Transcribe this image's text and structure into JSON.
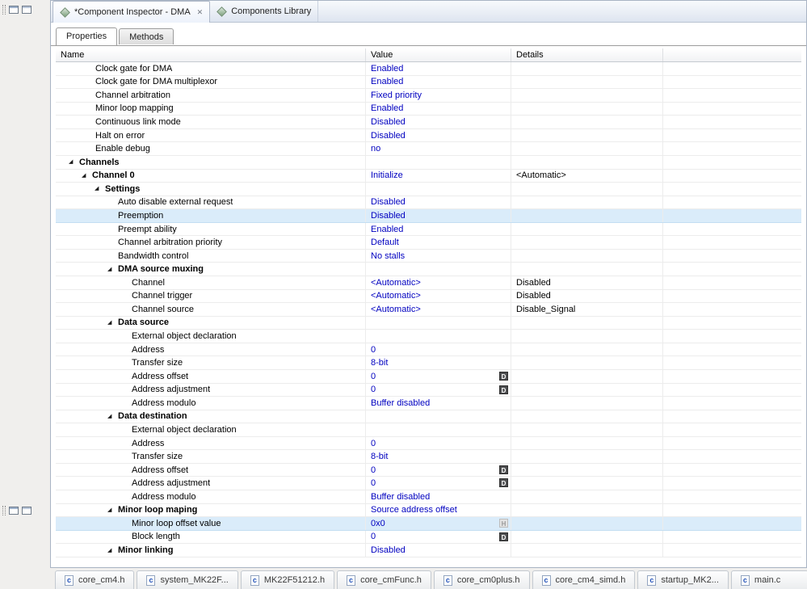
{
  "colors": {
    "value_text": "#0000c0",
    "selection_bg": "#daecfa",
    "tab_bar_bg": "#dde4f0",
    "badge_dark_bg": "#4d4e50",
    "badge_light_bg": "#e3e3e3"
  },
  "icons": {
    "close": "✕",
    "expander": "◢",
    "c_file": "c",
    "editor_tab_icon": "component-icon",
    "file_tab_icon": "c-file-icon"
  },
  "editor_tabs": [
    {
      "label": "*Component Inspector - DMA",
      "active": true,
      "closable": true
    },
    {
      "label": "Components Library",
      "active": false
    }
  ],
  "view_tabs": [
    {
      "label": "Properties",
      "active": true
    },
    {
      "label": "Methods",
      "active": false
    }
  ],
  "table": {
    "columns": [
      "Name",
      "Value",
      "Details",
      ""
    ],
    "rows": [
      {
        "indent": 49,
        "name": "Clock gate for DMA",
        "value": "Enabled"
      },
      {
        "indent": 49,
        "name": "Clock gate for DMA multiplexor",
        "value": "Enabled"
      },
      {
        "indent": 49,
        "name": "Channel arbitration",
        "value": "Fixed priority"
      },
      {
        "indent": 49,
        "name": "Minor loop mapping",
        "value": "Enabled"
      },
      {
        "indent": 49,
        "name": "Continuous link mode",
        "value": "Disabled"
      },
      {
        "indent": 49,
        "name": "Halt on error",
        "value": "Disabled"
      },
      {
        "indent": 49,
        "name": "Enable debug",
        "value": "no"
      },
      {
        "indent": 16,
        "name": "Channels",
        "group": true
      },
      {
        "indent": 32,
        "name": "Channel 0",
        "group": true,
        "value": "Initialize",
        "details": "<Automatic>"
      },
      {
        "indent": 48,
        "name": "Settings",
        "group": true
      },
      {
        "indent": 77,
        "name": "Auto disable external request",
        "value": "Disabled"
      },
      {
        "indent": 77,
        "name": "Preemption",
        "value": "Disabled",
        "selected": true
      },
      {
        "indent": 77,
        "name": "Preempt ability",
        "value": "Enabled"
      },
      {
        "indent": 77,
        "name": "Channel arbitration priority",
        "value": "Default"
      },
      {
        "indent": 77,
        "name": "Bandwidth control",
        "value": "No stalls"
      },
      {
        "indent": 64,
        "name": "DMA source muxing",
        "group": true
      },
      {
        "indent": 94,
        "name": "Channel",
        "value": "<Automatic>",
        "details": "Disabled"
      },
      {
        "indent": 94,
        "name": "Channel trigger",
        "value": "<Automatic>",
        "details": "Disabled"
      },
      {
        "indent": 94,
        "name": "Channel source",
        "value": "<Automatic>",
        "details": "Disable_Signal"
      },
      {
        "indent": 64,
        "name": "Data source",
        "group": true
      },
      {
        "indent": 94,
        "name": "External object declaration",
        "value": ""
      },
      {
        "indent": 94,
        "name": "Address",
        "value": "0"
      },
      {
        "indent": 94,
        "name": "Transfer size",
        "value": "8-bit"
      },
      {
        "indent": 94,
        "name": "Address offset",
        "value": "0",
        "badge": "D"
      },
      {
        "indent": 94,
        "name": "Address adjustment",
        "value": "0",
        "badge": "D"
      },
      {
        "indent": 94,
        "name": "Address modulo",
        "value": "Buffer disabled"
      },
      {
        "indent": 64,
        "name": "Data destination",
        "group": true
      },
      {
        "indent": 94,
        "name": "External object declaration",
        "value": ""
      },
      {
        "indent": 94,
        "name": "Address",
        "value": "0"
      },
      {
        "indent": 94,
        "name": "Transfer size",
        "value": "8-bit"
      },
      {
        "indent": 94,
        "name": "Address offset",
        "value": "0",
        "badge": "D"
      },
      {
        "indent": 94,
        "name": "Address adjustment",
        "value": "0",
        "badge": "D"
      },
      {
        "indent": 94,
        "name": "Address modulo",
        "value": "Buffer disabled"
      },
      {
        "indent": 64,
        "name": "Minor loop maping",
        "group": true,
        "value": "Source address offset"
      },
      {
        "indent": 94,
        "name": "Minor loop offset value",
        "value": "0x0",
        "badge": "H",
        "selected": true
      },
      {
        "indent": 94,
        "name": "Block length",
        "value": "0",
        "badge": "D"
      },
      {
        "indent": 64,
        "name": "Minor linking",
        "group": true,
        "value": "Disabled"
      }
    ]
  },
  "bottom_tabs": [
    {
      "label": "core_cm4.h"
    },
    {
      "label": "system_MK22F..."
    },
    {
      "label": "MK22F51212.h"
    },
    {
      "label": "core_cmFunc.h"
    },
    {
      "label": "core_cm0plus.h"
    },
    {
      "label": "core_cm4_simd.h"
    },
    {
      "label": "startup_MK2..."
    },
    {
      "label": "main.c"
    }
  ]
}
